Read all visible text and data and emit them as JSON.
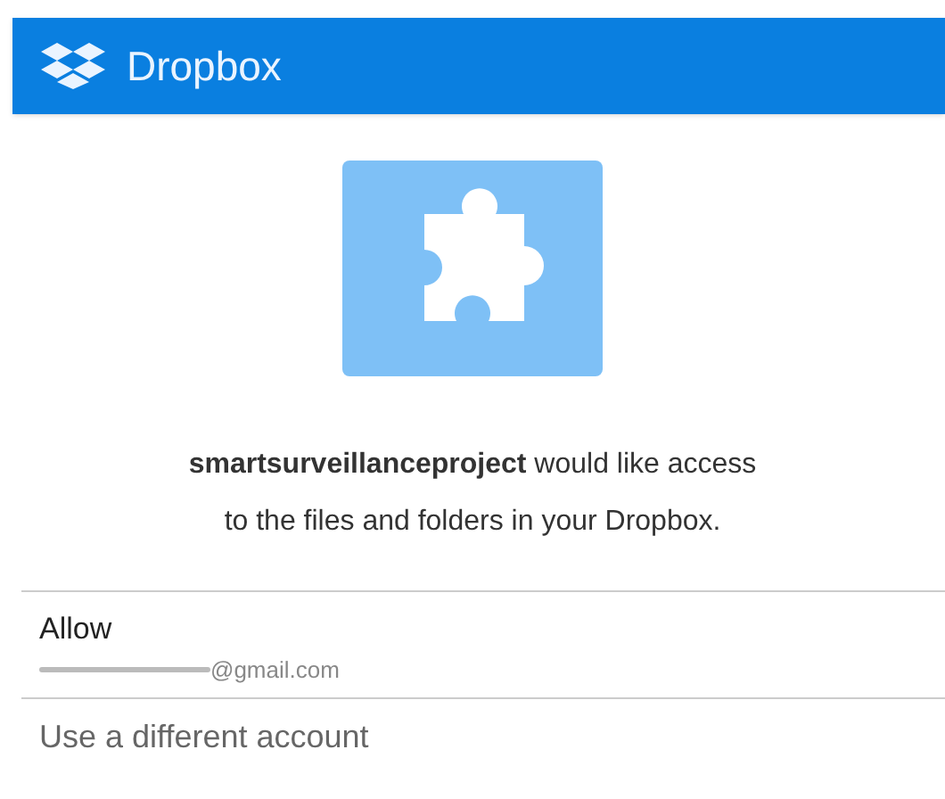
{
  "app_bar": {
    "title": "Dropbox"
  },
  "message": "**smartsurveillanceproject** would like access to the files and folders in your Dropbox.",
  "options": [
    {
      "kind": "account",
      "label": "Allow",
      "email": "@gmail.com"
    },
    {
      "kind": "plain",
      "label": "Use a different account"
    }
  ]
}
